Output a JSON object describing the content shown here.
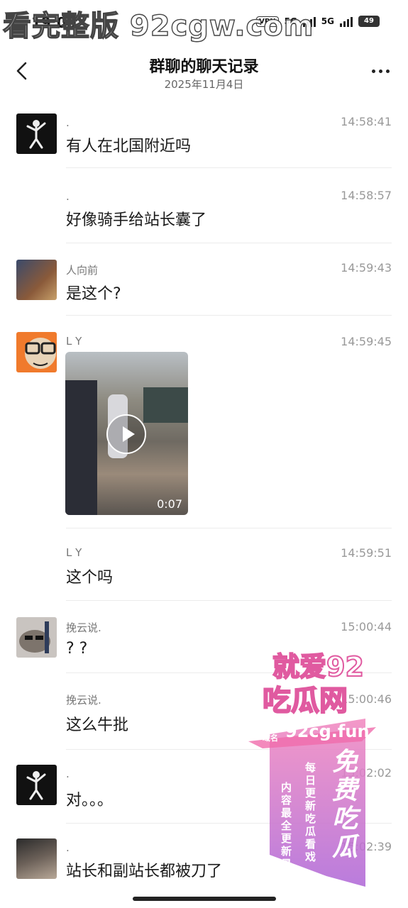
{
  "status_bar": {
    "time": "19:00",
    "vpn": "VPN",
    "net1": "5G",
    "net2": "5G",
    "battery": "49"
  },
  "watermark": "看完整版 92cgw.com",
  "nav": {
    "title": "群聊的聊天记录",
    "subtitle": "2025年11月4日"
  },
  "messages": [
    {
      "sender": ".",
      "time": "14:58:41",
      "text": "有人在北国附近吗",
      "avatar": "dancing-skeleton"
    },
    {
      "sender": ".",
      "time": "14:58:57",
      "text": "好像骑手给站长囊了"
    },
    {
      "sender": "人向前",
      "time": "14:59:43",
      "text": "是这个?",
      "avatar": "cartoon-character"
    },
    {
      "sender": "L Y",
      "time": "14:59:45",
      "video_duration": "0:07",
      "avatar": "glasses-cartoon"
    },
    {
      "sender": "L Y",
      "time": "14:59:51",
      "text": "这个吗"
    },
    {
      "sender": "挽云说.",
      "time": "15:00:44",
      "text": "? ?",
      "avatar": "cat-with-sunglasses"
    },
    {
      "sender": "挽云说.",
      "time": "15:00:46",
      "text": "这么牛批"
    },
    {
      "sender": ".",
      "time": "15:02:02",
      "text": "对。。。",
      "avatar": "dancing-skeleton"
    },
    {
      "sender": ".",
      "time": "15:02:39",
      "text": "站长和副站长都被刀了",
      "avatar": "hooded-person"
    }
  ],
  "ad": {
    "line1": "就爱92",
    "line2": "吃瓜网",
    "domain_label": "永久域名",
    "domain": "92cg.fun",
    "tagline1": "每日更新 吃瓜看戏",
    "tagline2": "内容最全 更新最快",
    "big": "免费吃瓜"
  }
}
